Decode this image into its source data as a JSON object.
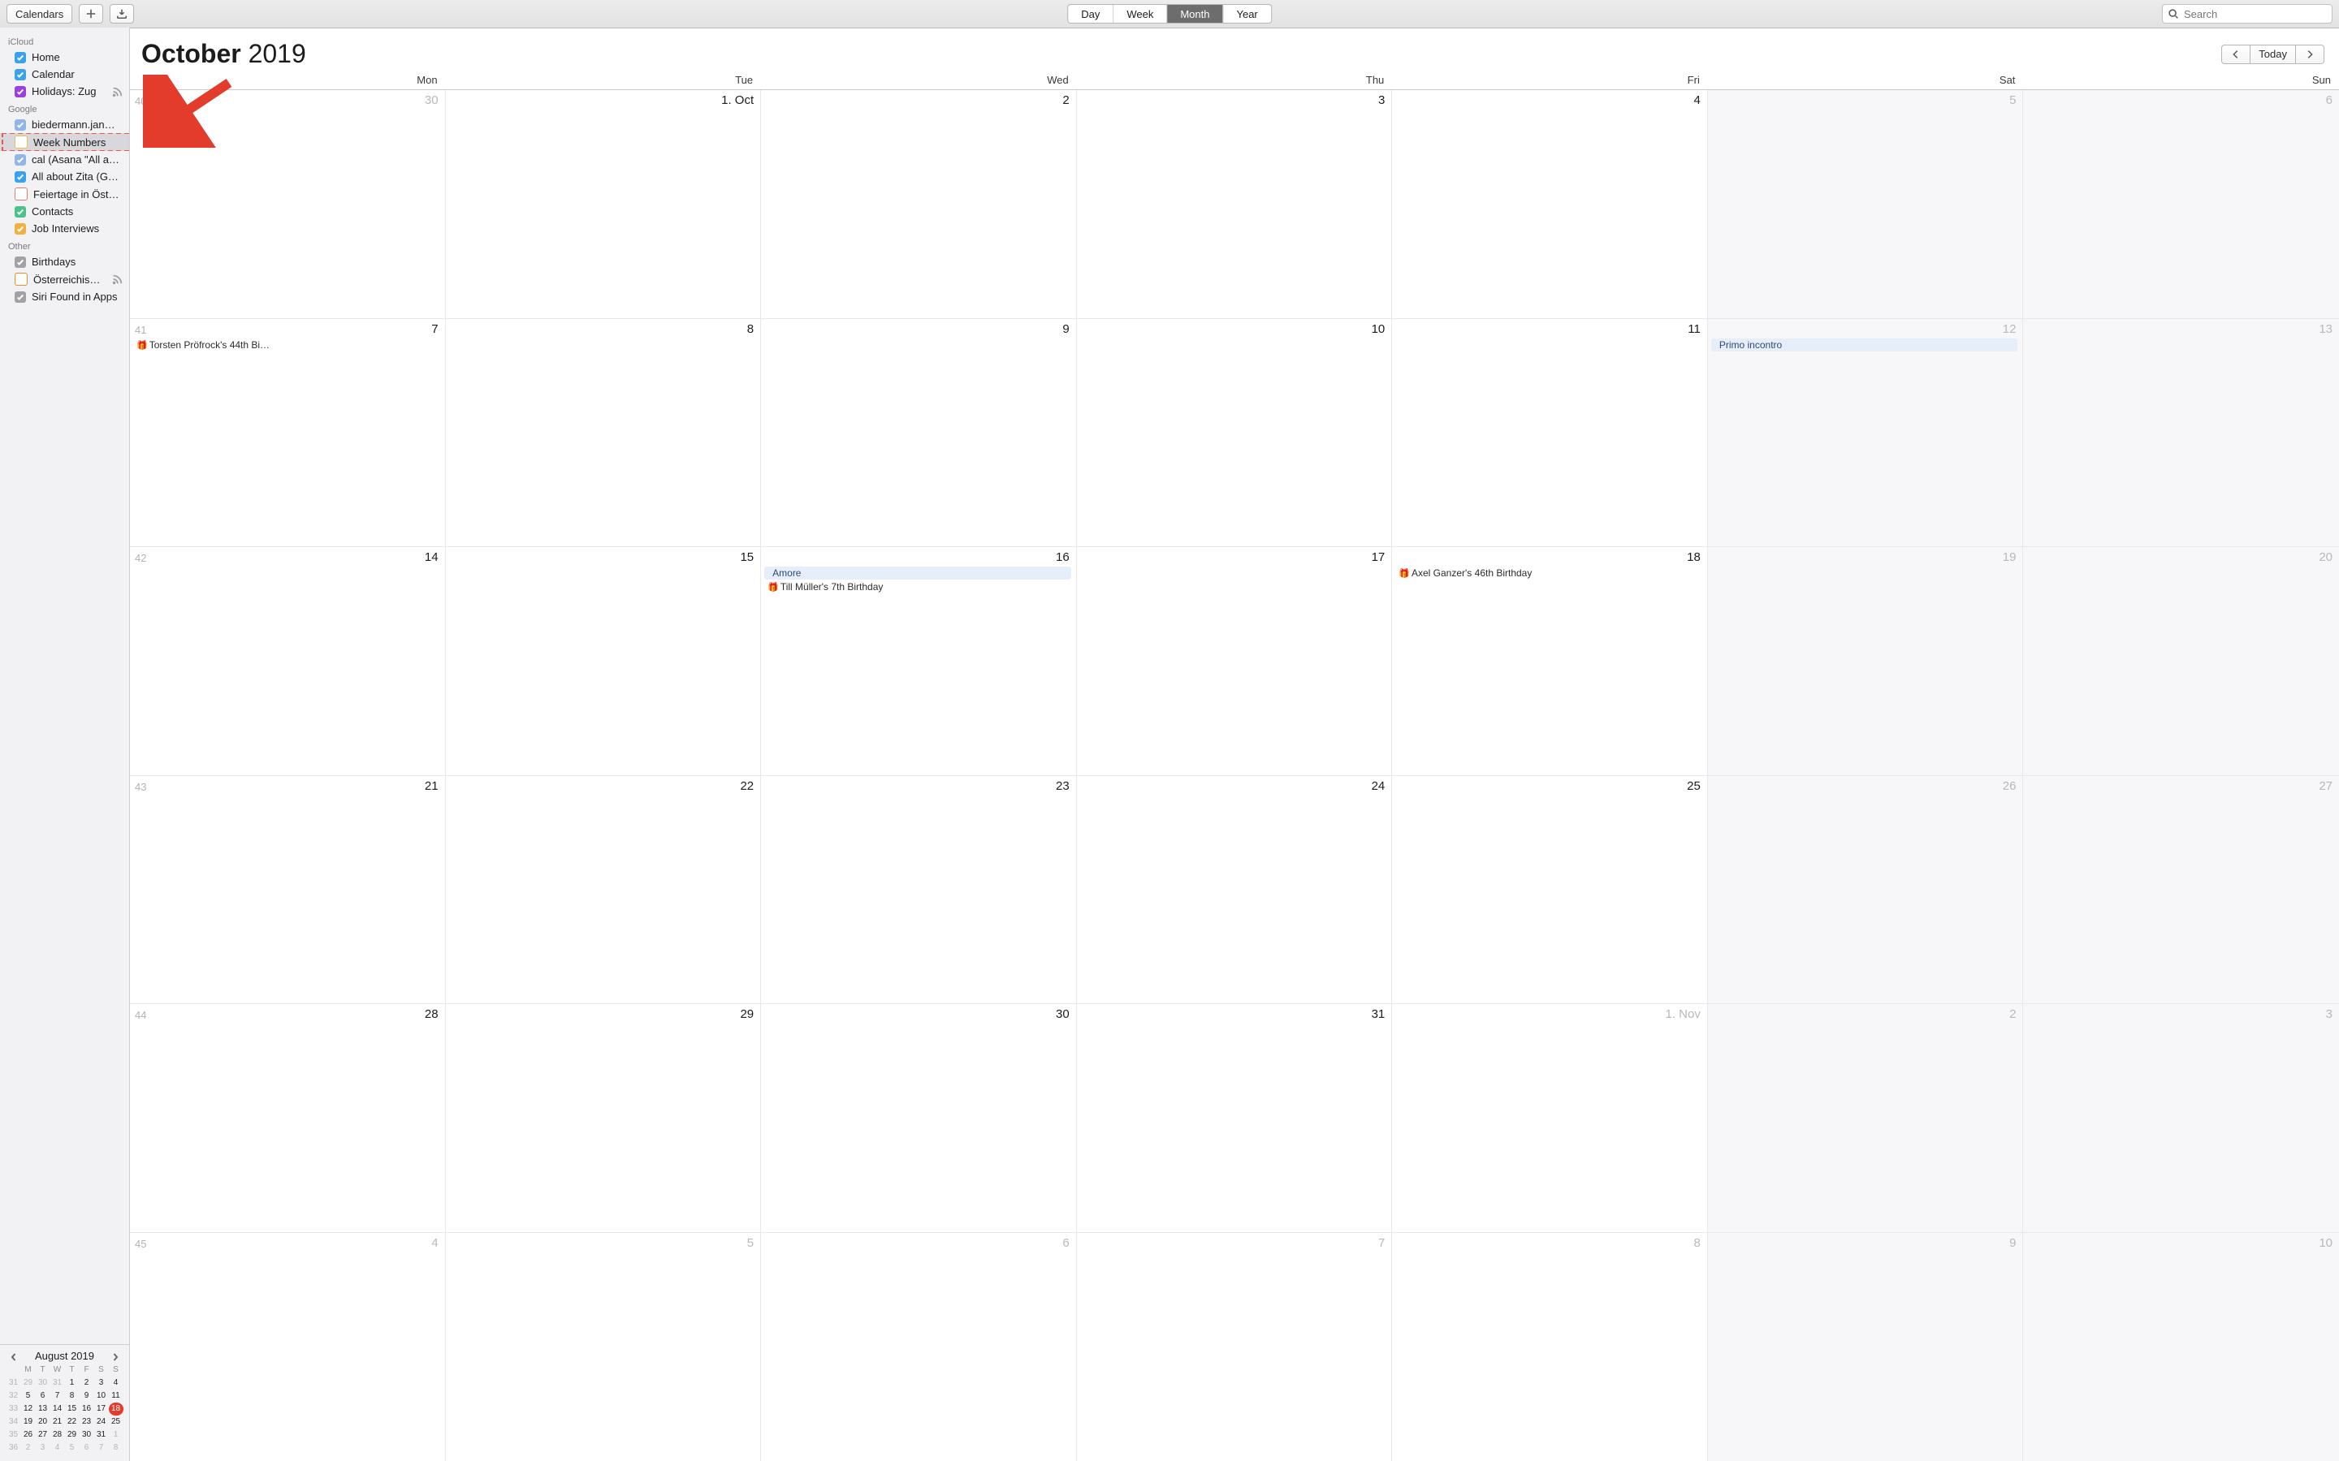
{
  "toolbar": {
    "calendars_label": "Calendars",
    "search_placeholder": "Search",
    "views": [
      {
        "label": "Day",
        "active": false
      },
      {
        "label": "Week",
        "active": false
      },
      {
        "label": "Month",
        "active": true
      },
      {
        "label": "Year",
        "active": false
      }
    ]
  },
  "sidebar": {
    "groups": [
      {
        "label": "iCloud",
        "items": [
          {
            "label": "Home",
            "color": "#37a3ef",
            "checked": true
          },
          {
            "label": "Calendar",
            "color": "#37a3ef",
            "checked": true
          },
          {
            "label": "Holidays: Zug",
            "color": "#9b3fe0",
            "checked": true,
            "rss": true
          }
        ]
      },
      {
        "label": "Google",
        "items": [
          {
            "label": "biedermann.jan…",
            "color": "#8fb6e6",
            "checked": true
          },
          {
            "label": "Week Numbers",
            "color": "#e6c44d",
            "checked": false,
            "selected": true,
            "dashed": true
          },
          {
            "label": "cal (Asana \"All a…",
            "color": "#8fb6e6",
            "checked": true
          },
          {
            "label": "All about Zita (G…",
            "color": "#37a3ef",
            "checked": true
          },
          {
            "label": "Feiertage in Öst…",
            "color": "#e07b7b",
            "checked": false
          },
          {
            "label": "Contacts",
            "color": "#4ac28c",
            "checked": true
          },
          {
            "label": "Job Interviews",
            "color": "#f0b23e",
            "checked": true
          }
        ]
      },
      {
        "label": "Other",
        "items": [
          {
            "label": "Birthdays",
            "color": "#a1a1a6",
            "checked": true
          },
          {
            "label": "Österreichis…",
            "color": "#f28a2e",
            "checked": false,
            "rss": true
          },
          {
            "label": "Siri Found in Apps",
            "color": "#a1a1a6",
            "checked": true
          }
        ]
      }
    ]
  },
  "mini": {
    "title": "August 2019",
    "dow": [
      "",
      "M",
      "T",
      "W",
      "T",
      "F",
      "S",
      "S"
    ],
    "rows": [
      {
        "wk": "31",
        "days": [
          {
            "n": "29",
            "dim": true
          },
          {
            "n": "30",
            "dim": true
          },
          {
            "n": "31",
            "dim": true
          },
          {
            "n": "1"
          },
          {
            "n": "2"
          },
          {
            "n": "3"
          },
          {
            "n": "4"
          }
        ]
      },
      {
        "wk": "32",
        "days": [
          {
            "n": "5"
          },
          {
            "n": "6"
          },
          {
            "n": "7"
          },
          {
            "n": "8"
          },
          {
            "n": "9"
          },
          {
            "n": "10"
          },
          {
            "n": "11"
          }
        ]
      },
      {
        "wk": "33",
        "days": [
          {
            "n": "12"
          },
          {
            "n": "13"
          },
          {
            "n": "14"
          },
          {
            "n": "15"
          },
          {
            "n": "16"
          },
          {
            "n": "17"
          },
          {
            "n": "18",
            "today": true
          }
        ]
      },
      {
        "wk": "34",
        "days": [
          {
            "n": "19"
          },
          {
            "n": "20"
          },
          {
            "n": "21"
          },
          {
            "n": "22"
          },
          {
            "n": "23"
          },
          {
            "n": "24"
          },
          {
            "n": "25"
          }
        ]
      },
      {
        "wk": "35",
        "days": [
          {
            "n": "26"
          },
          {
            "n": "27"
          },
          {
            "n": "28"
          },
          {
            "n": "29"
          },
          {
            "n": "30"
          },
          {
            "n": "31"
          },
          {
            "n": "1",
            "dim": true
          }
        ]
      },
      {
        "wk": "36",
        "days": [
          {
            "n": "2",
            "dim": true
          },
          {
            "n": "3",
            "dim": true
          },
          {
            "n": "4",
            "dim": true
          },
          {
            "n": "5",
            "dim": true
          },
          {
            "n": "6",
            "dim": true
          },
          {
            "n": "7",
            "dim": true
          },
          {
            "n": "8",
            "dim": true
          }
        ]
      }
    ]
  },
  "main": {
    "title_month": "October",
    "title_year": "2019",
    "today_label": "Today",
    "dow": [
      "Mon",
      "Tue",
      "Wed",
      "Thu",
      "Fri",
      "Sat",
      "Sun"
    ],
    "weeks": [
      {
        "wk": "40",
        "days": [
          {
            "label": "30",
            "other": true
          },
          {
            "label": "1. Oct"
          },
          {
            "label": "2"
          },
          {
            "label": "3"
          },
          {
            "label": "4"
          },
          {
            "label": "5",
            "wknd": true,
            "other": true
          },
          {
            "label": "6",
            "wknd": true,
            "other": true
          }
        ]
      },
      {
        "wk": "41",
        "days": [
          {
            "label": "7",
            "events": [
              {
                "text": "Torsten Pröfrock's 44th Bi…",
                "birthday": true
              }
            ]
          },
          {
            "label": "8"
          },
          {
            "label": "9"
          },
          {
            "label": "10"
          },
          {
            "label": "11"
          },
          {
            "label": "12",
            "wknd": true,
            "other": true,
            "events": [
              {
                "text": "Primo incontro",
                "bg": true
              }
            ]
          },
          {
            "label": "13",
            "wknd": true,
            "other": true
          }
        ]
      },
      {
        "wk": "42",
        "days": [
          {
            "label": "14"
          },
          {
            "label": "15"
          },
          {
            "label": "16",
            "events": [
              {
                "text": "Amore",
                "bg": true
              },
              {
                "text": "Till Müller's 7th Birthday",
                "birthday": true
              }
            ]
          },
          {
            "label": "17"
          },
          {
            "label": "18",
            "events": [
              {
                "text": "Axel Ganzer's 46th Birthday",
                "birthday": true
              }
            ]
          },
          {
            "label": "19",
            "wknd": true,
            "other": true
          },
          {
            "label": "20",
            "wknd": true,
            "other": true
          }
        ]
      },
      {
        "wk": "43",
        "days": [
          {
            "label": "21"
          },
          {
            "label": "22"
          },
          {
            "label": "23"
          },
          {
            "label": "24"
          },
          {
            "label": "25"
          },
          {
            "label": "26",
            "wknd": true,
            "other": true
          },
          {
            "label": "27",
            "wknd": true,
            "other": true
          }
        ]
      },
      {
        "wk": "44",
        "days": [
          {
            "label": "28"
          },
          {
            "label": "29"
          },
          {
            "label": "30"
          },
          {
            "label": "31"
          },
          {
            "label": "1. Nov",
            "other": true
          },
          {
            "label": "2",
            "wknd": true,
            "other": true
          },
          {
            "label": "3",
            "wknd": true,
            "other": true
          }
        ]
      },
      {
        "wk": "45",
        "days": [
          {
            "label": "4",
            "other": true
          },
          {
            "label": "5",
            "other": true
          },
          {
            "label": "6",
            "other": true
          },
          {
            "label": "7",
            "other": true
          },
          {
            "label": "8",
            "other": true
          },
          {
            "label": "9",
            "wknd": true,
            "other": true
          },
          {
            "label": "10",
            "wknd": true,
            "other": true
          }
        ]
      }
    ]
  }
}
